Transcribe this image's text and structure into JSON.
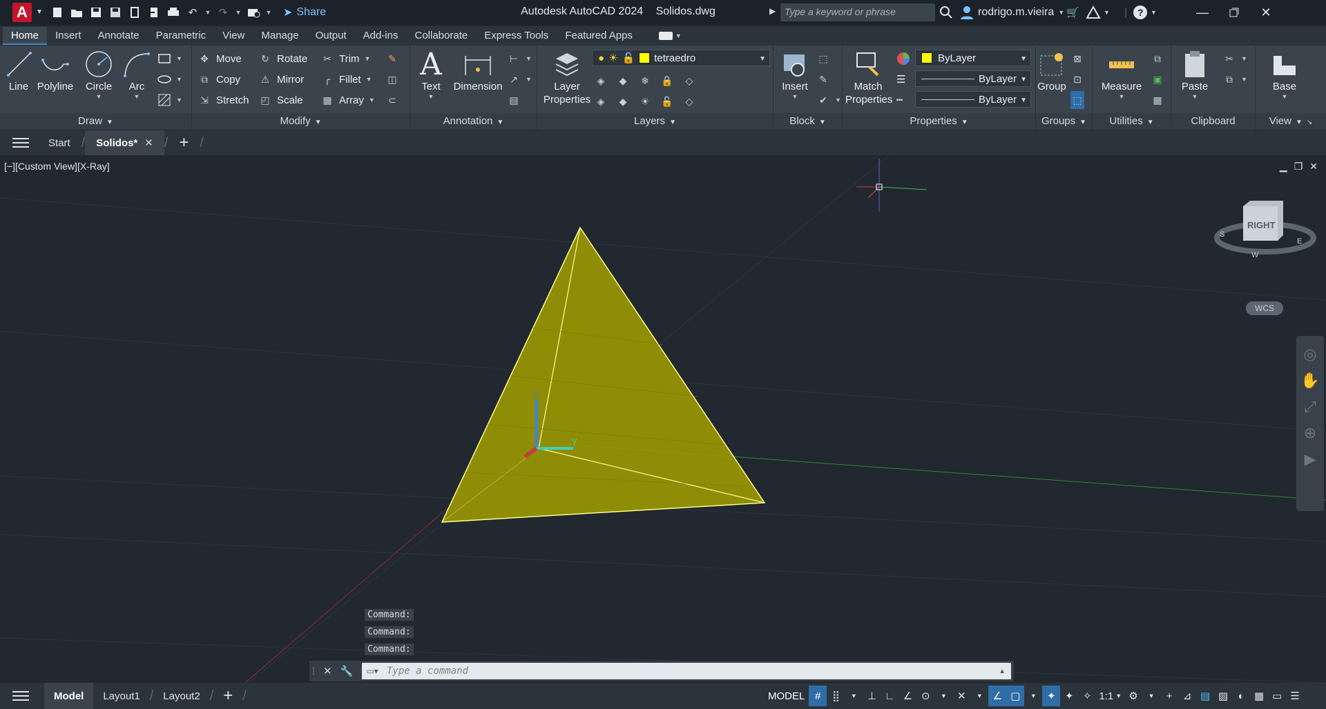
{
  "titlebar": {
    "app_name": "Autodesk AutoCAD 2024",
    "file_name": "Solidos.dwg",
    "share_label": "Share",
    "search_placeholder": "Type a keyword or phrase",
    "user_name": "rodrigo.m.vieira",
    "logo_letter": "A"
  },
  "ribbon_tabs": [
    "Home",
    "Insert",
    "Annotate",
    "Parametric",
    "View",
    "Manage",
    "Output",
    "Add-ins",
    "Collaborate",
    "Express Tools",
    "Featured Apps"
  ],
  "ribbon": {
    "draw": {
      "title": "Draw",
      "line": "Line",
      "polyline": "Polyline",
      "circle": "Circle",
      "arc": "Arc"
    },
    "modify": {
      "title": "Modify",
      "move": "Move",
      "rotate": "Rotate",
      "trim": "Trim",
      "copy": "Copy",
      "mirror": "Mirror",
      "fillet": "Fillet",
      "stretch": "Stretch",
      "scale": "Scale",
      "array": "Array"
    },
    "annotation": {
      "title": "Annotation",
      "text": "Text",
      "dimension": "Dimension"
    },
    "layers": {
      "title": "Layers",
      "layer_properties_1": "Layer",
      "layer_properties_2": "Properties",
      "current_layer": "tetraedro"
    },
    "block": {
      "title": "Block",
      "insert": "Insert"
    },
    "properties": {
      "title": "Properties",
      "match_1": "Match",
      "match_2": "Properties",
      "color": "ByLayer",
      "linetype": "ByLayer",
      "lineweight": "ByLayer"
    },
    "groups": {
      "title": "Groups",
      "group": "Group"
    },
    "utilities": {
      "title": "Utilities",
      "measure": "Measure"
    },
    "clipboard": {
      "title": "Clipboard",
      "paste": "Paste"
    },
    "view": {
      "title": "View",
      "base": "Base"
    }
  },
  "file_tabs": {
    "start": "Start",
    "active": "Solidos*"
  },
  "viewport": {
    "label": "[−][Custom View][X-Ray]",
    "viewcube_face": "RIGHT",
    "wcs": "WCS",
    "ucs_z": "Z",
    "ucs_y": "Y"
  },
  "command": {
    "history": [
      "Command:",
      "Command:",
      "Command:"
    ],
    "placeholder": "Type a command"
  },
  "status": {
    "model_tab": "Model",
    "layout1": "Layout1",
    "layout2": "Layout2",
    "model_label": "MODEL",
    "scale": "1:1"
  },
  "colors": {
    "accent": "#2f6da8",
    "solid_fill": "#a7a300",
    "logo_red": "#c4152c"
  }
}
